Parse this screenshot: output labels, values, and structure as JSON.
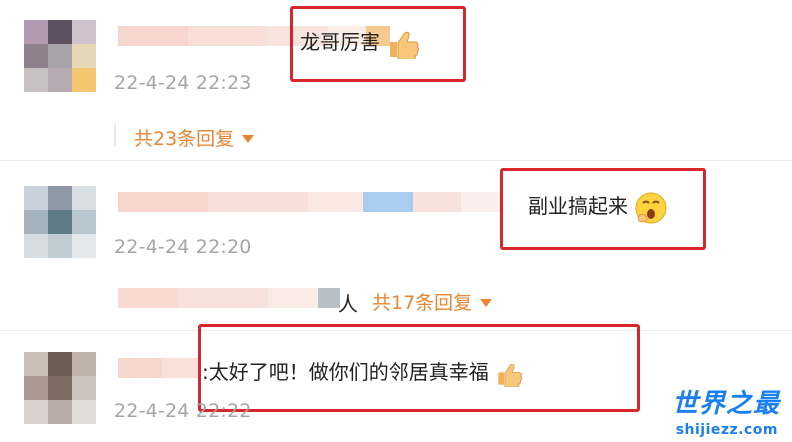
{
  "comments": [
    {
      "text": "龙哥厉害",
      "emoji": "thumbs-up",
      "time": "22-4-24 22:23",
      "replies_label": "共23条回复",
      "reply_prefix": ""
    },
    {
      "text": "副业搞起来",
      "emoji": "yawning-face",
      "time": "22-4-24 22:20",
      "replies_label": "共17条回复",
      "reply_prefix": "人"
    },
    {
      "text": ":太好了吧！做你们的邻居真幸福",
      "emoji": "thumbs-up",
      "time": "22-4-24 22:22",
      "replies_label": "",
      "reply_prefix": ""
    }
  ],
  "watermark": {
    "title": "世界之最",
    "url": "shijiezz.com"
  },
  "colors": {
    "highlight_box": "#d9262c",
    "reply_link": "#ea8632",
    "timestamp": "#a6a6a6",
    "watermark": "#1a7ff2"
  }
}
